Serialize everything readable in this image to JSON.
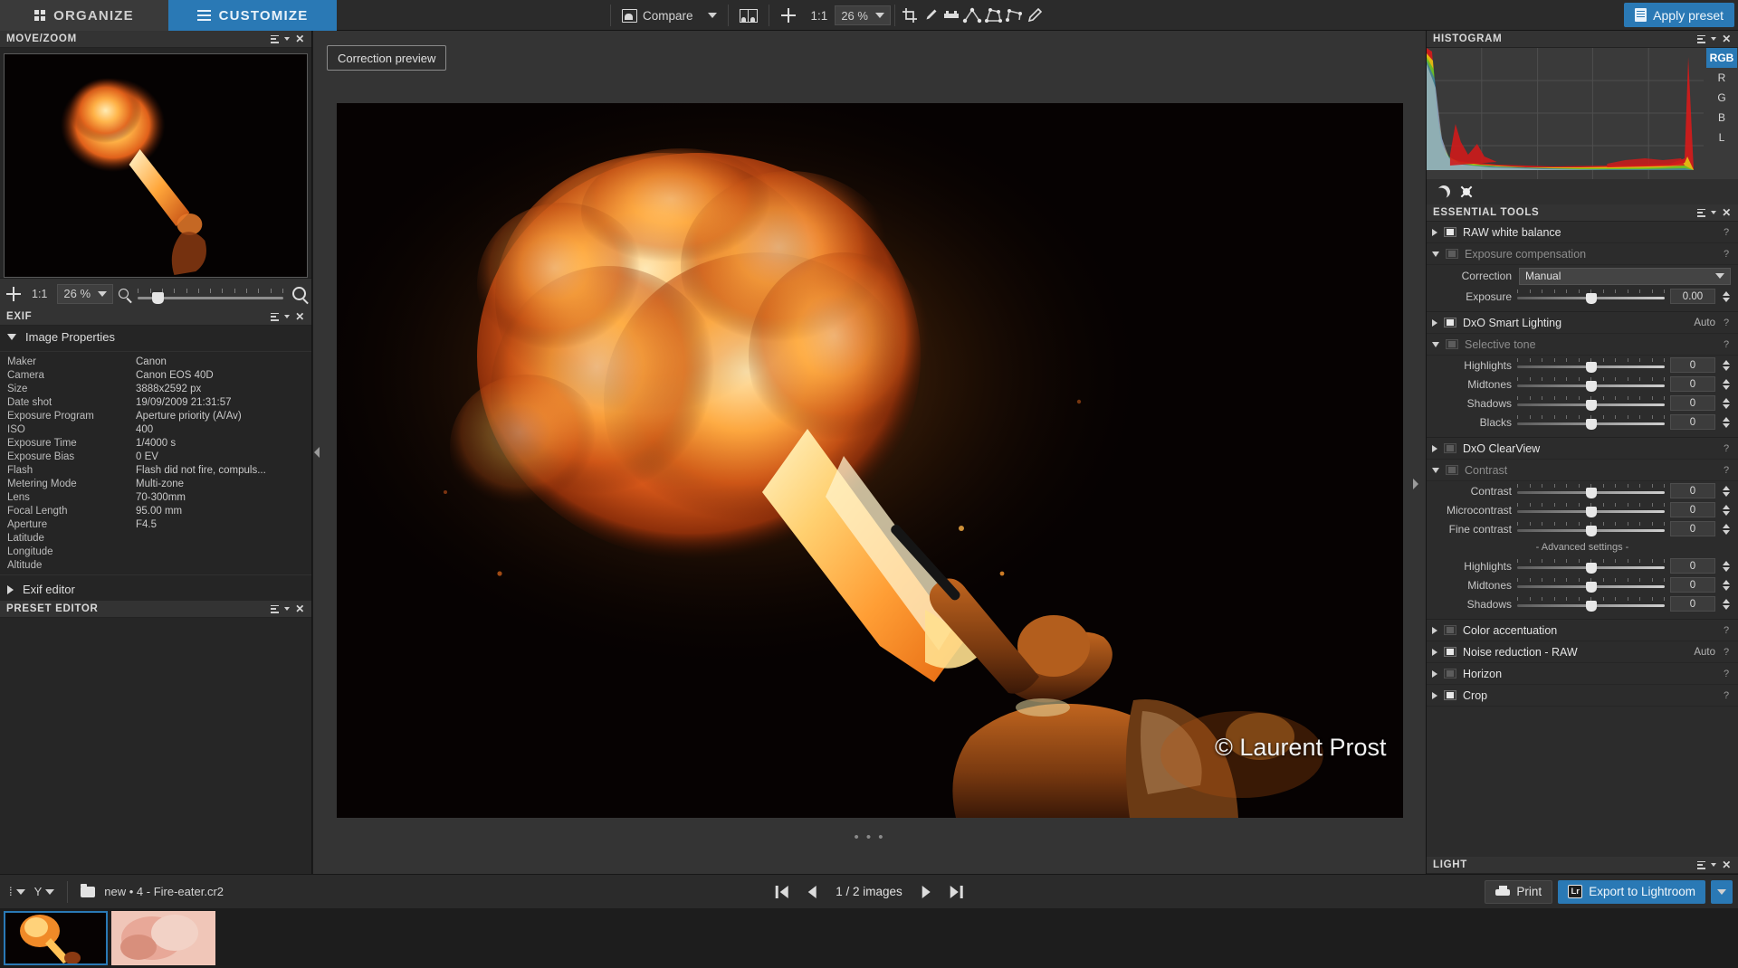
{
  "top": {
    "tabs": [
      {
        "label": "ORGANIZE",
        "icon": "grid-icon",
        "active": false
      },
      {
        "label": "CUSTOMIZE",
        "icon": "sliders-icon",
        "active": true
      }
    ],
    "compare_label": "Compare",
    "ratio_label": "1:1",
    "zoom_value": "26 %",
    "apply_preset_label": "Apply preset",
    "tools": [
      "crop-icon",
      "eyedropper-icon",
      "horizon-icon",
      "perspective-icon",
      "rectangle-perspective-icon",
      "volume-deformation-icon",
      "retouch-icon"
    ]
  },
  "left": {
    "movezoom": {
      "title": "MOVE/ZOOM",
      "ratio_label": "1:1",
      "zoom_value": "26 %"
    },
    "exif": {
      "title": "EXIF",
      "section_label": "Image Properties",
      "rows": [
        {
          "key": "Maker",
          "value": "Canon"
        },
        {
          "key": "Camera",
          "value": "Canon EOS 40D"
        },
        {
          "key": "Size",
          "value": "3888x2592 px"
        },
        {
          "key": "Date shot",
          "value": "19/09/2009 21:31:57"
        },
        {
          "key": "Exposure Program",
          "value": "Aperture priority (A/Av)"
        },
        {
          "key": "ISO",
          "value": "400"
        },
        {
          "key": "Exposure Time",
          "value": "1/4000 s"
        },
        {
          "key": "Exposure Bias",
          "value": "0 EV"
        },
        {
          "key": "Flash",
          "value": "Flash did not fire, compuls..."
        },
        {
          "key": "Metering Mode",
          "value": "Multi-zone"
        },
        {
          "key": "Lens",
          "value": "70-300mm"
        },
        {
          "key": "Focal Length",
          "value": "95.00 mm"
        },
        {
          "key": "Aperture",
          "value": "F4.5"
        },
        {
          "key": "Latitude",
          "value": ""
        },
        {
          "key": "Longitude",
          "value": ""
        },
        {
          "key": "Altitude",
          "value": ""
        }
      ],
      "editor_label": "Exif editor"
    },
    "preset_editor": {
      "title": "PRESET EDITOR"
    }
  },
  "center": {
    "correction_preview_label": "Correction preview",
    "watermark": "© Laurent Prost"
  },
  "right": {
    "histogram": {
      "title": "HISTOGRAM",
      "channels": [
        {
          "label": "RGB",
          "active": true
        },
        {
          "label": "R",
          "active": false
        },
        {
          "label": "G",
          "active": false
        },
        {
          "label": "B",
          "active": false
        },
        {
          "label": "L",
          "active": false
        }
      ]
    },
    "essential_tools": {
      "title": "ESSENTIAL TOOLS",
      "items": [
        {
          "label": "RAW white balance",
          "state": "collapsed",
          "enabled": true,
          "auto": "",
          "help": "?"
        },
        {
          "label": "Exposure compensation",
          "state": "expanded",
          "enabled": false,
          "auto": "",
          "help": "?"
        },
        {
          "label": "DxO Smart Lighting",
          "state": "collapsed",
          "enabled": true,
          "auto": "Auto",
          "help": "?"
        },
        {
          "label": "Selective tone",
          "state": "expanded",
          "enabled": false,
          "auto": "",
          "help": "?"
        },
        {
          "label": "DxO ClearView",
          "state": "collapsed",
          "enabled": false,
          "auto": "",
          "help": "?"
        },
        {
          "label": "Contrast",
          "state": "expanded",
          "enabled": false,
          "auto": "",
          "help": "?"
        },
        {
          "label": "Color accentuation",
          "state": "collapsed",
          "enabled": false,
          "auto": "",
          "help": "?"
        },
        {
          "label": "Noise reduction - RAW",
          "state": "collapsed",
          "enabled": true,
          "auto": "Auto",
          "help": "?"
        },
        {
          "label": "Horizon",
          "state": "collapsed",
          "enabled": false,
          "auto": "",
          "help": "?"
        },
        {
          "label": "Crop",
          "state": "collapsed",
          "enabled": true,
          "auto": "",
          "help": "?"
        }
      ],
      "exposure": {
        "correction_label": "Correction",
        "correction_value": "Manual",
        "exposure_label": "Exposure",
        "exposure_value": "0.00"
      },
      "selective_tone": [
        {
          "label": "Highlights",
          "value": "0"
        },
        {
          "label": "Midtones",
          "value": "0"
        },
        {
          "label": "Shadows",
          "value": "0"
        },
        {
          "label": "Blacks",
          "value": "0"
        }
      ],
      "contrast": {
        "basic": [
          {
            "label": "Contrast",
            "value": "0"
          },
          {
            "label": "Microcontrast",
            "value": "0"
          },
          {
            "label": "Fine contrast",
            "value": "0"
          }
        ],
        "advanced_label": "- Advanced settings -",
        "advanced": [
          {
            "label": "Highlights",
            "value": "0"
          },
          {
            "label": "Midtones",
            "value": "0"
          },
          {
            "label": "Shadows",
            "value": "0"
          }
        ]
      }
    },
    "light": {
      "title": "LIGHT"
    }
  },
  "bottom": {
    "breadcrumb": "new • 4 - Fire-eater.cr2",
    "counter": "1 / 2",
    "counter_unit": "images",
    "print_label": "Print",
    "export_label": "Export to Lightroom",
    "lr_badge": "Lr"
  },
  "colors": {
    "accent": "#2a79b5",
    "panel": "#2c2c2c",
    "panel_dark": "#232323",
    "header": "#333333"
  }
}
